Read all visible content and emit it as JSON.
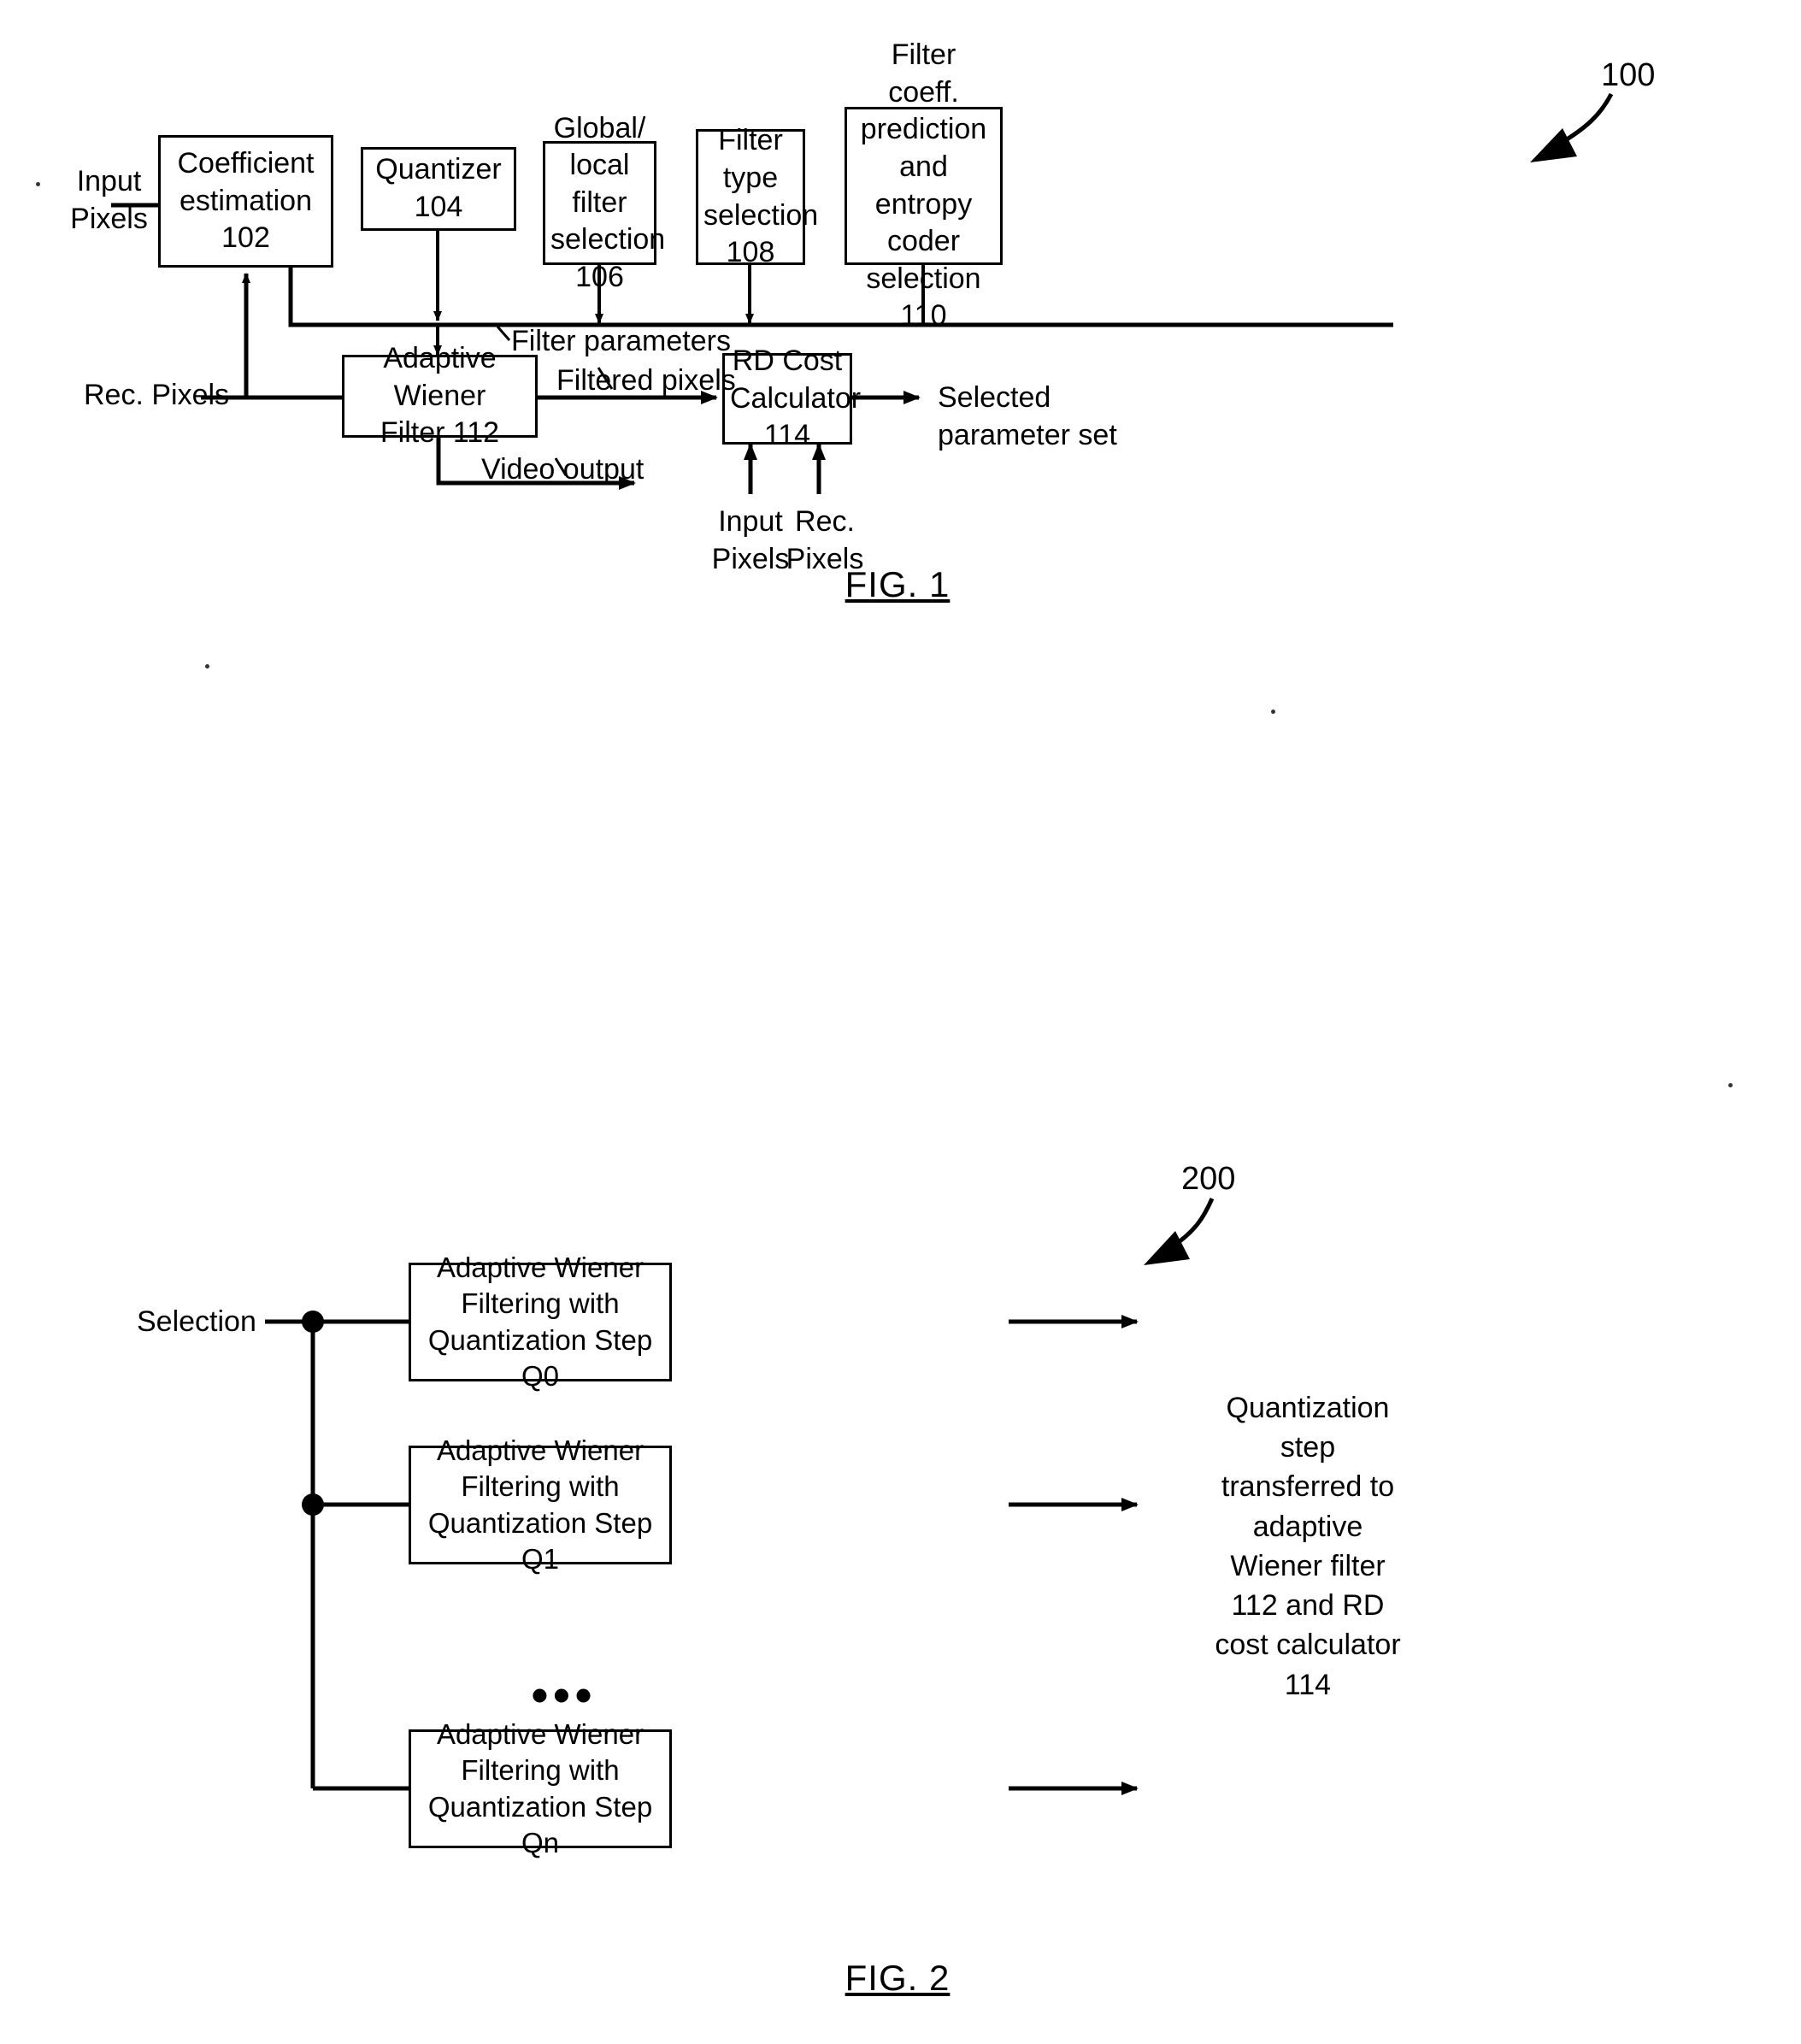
{
  "figures": [
    {
      "id": "fig1",
      "caption": "FIG. 1",
      "ref_number": "100",
      "boxes": [
        {
          "name": "coefficient-estimation",
          "lines": [
            "Coefficient",
            "estimation 102"
          ]
        },
        {
          "name": "quantizer",
          "lines": [
            "Quantizer",
            "104"
          ]
        },
        {
          "name": "global-local-filter-selection",
          "lines": [
            "Global/",
            "local filter",
            "selection",
            "106"
          ]
        },
        {
          "name": "filter-type-selection",
          "lines": [
            "Filter",
            "type",
            "selection",
            "108"
          ]
        },
        {
          "name": "filter-coeff-prediction-entropy-coder",
          "lines": [
            "Filter coeff.",
            "prediction",
            "and entropy",
            "coder",
            "selection 110"
          ]
        },
        {
          "name": "adaptive-wiener-filter",
          "lines": [
            "Adaptive Wiener",
            "Filter 112"
          ]
        },
        {
          "name": "rd-cost-calculator",
          "lines": [
            "RD Cost",
            "Calculator",
            "114"
          ]
        }
      ],
      "labels": {
        "input_pixels_top": "Input\nPixels",
        "rec_pixels_left": "Rec. Pixels",
        "filter_parameters": "Filter parameters",
        "filtered_pixels": "Filtered pixels",
        "video_output": "Video output",
        "selected_parameter_set": "Selected\nparameter set",
        "input_pixels_bottom": "Input\nPixels",
        "rec_pixels_bottom": "Rec.\nPixels"
      }
    },
    {
      "id": "fig2",
      "caption": "FIG. 2",
      "ref_number": "200",
      "boxes": [
        {
          "name": "awf-q0",
          "lines": [
            "Adaptive Wiener",
            "Filtering with",
            "Quantization Step Q0"
          ]
        },
        {
          "name": "awf-q1",
          "lines": [
            "Adaptive Wiener",
            "Filtering with",
            "Quantization Step Q1"
          ]
        },
        {
          "name": "awf-qn",
          "lines": [
            "Adaptive Wiener",
            "Filtering with",
            "Quantization Step Qn"
          ]
        }
      ],
      "labels": {
        "selection": "Selection",
        "ellipsis": "•••",
        "output_note": "Quantization\nstep\ntransferred to\nadaptive\nWiener filter\n112 and RD\ncost calculator\n114"
      }
    }
  ],
  "colors": {
    "ink": "#000000",
    "paper": "#ffffff"
  }
}
